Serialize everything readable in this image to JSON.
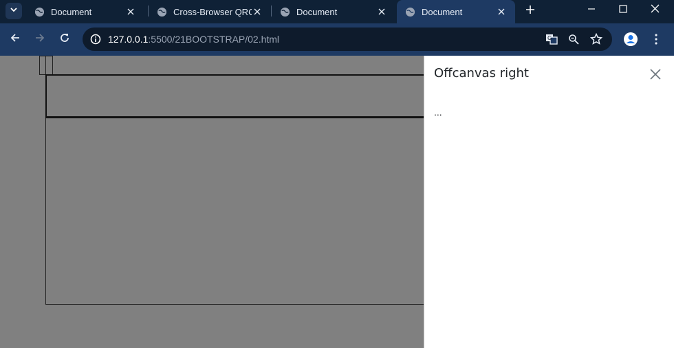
{
  "browser": {
    "tabs": [
      {
        "title": "Document",
        "active": false
      },
      {
        "title": "Cross-Browser QRC",
        "active": false
      },
      {
        "title": "Document",
        "active": false
      },
      {
        "title": "Document",
        "active": true
      }
    ],
    "url": {
      "host": "127.0.0.1",
      "path": ":5500/21BOOTSTRAP/02.html"
    },
    "icons": [
      "tab-search-icon",
      "globe-icon",
      "close-icon",
      "new-tab-icon",
      "minimize-icon",
      "maximize-icon",
      "back-icon",
      "forward-icon",
      "reload-icon",
      "site-info-icon",
      "translate-icon",
      "zoom-icon",
      "star-icon",
      "profile-icon",
      "menu-icon"
    ]
  },
  "offcanvas": {
    "title": "Offcanvas right",
    "body": "..."
  },
  "colors": {
    "tabstrip": "#0f2136",
    "toolbar": "#1e3a63",
    "backdrop": "#808080",
    "panel": "#ffffff"
  }
}
